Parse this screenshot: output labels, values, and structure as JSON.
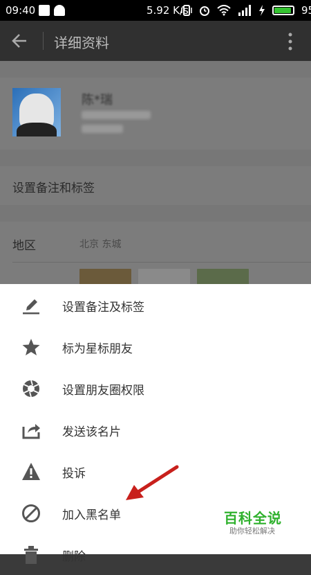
{
  "status_bar": {
    "time": "09:40",
    "network_speed": "5.92 K/s",
    "battery": "95",
    "battery_level": 0.95,
    "battery_color": "#35c431"
  },
  "app_bar": {
    "title": "详细资料",
    "back_icon": "back-arrow-icon",
    "more_icon": "more-vertical-icon"
  },
  "profile": {
    "nickname": "陈*瑞"
  },
  "rows": {
    "remark_label": "设置备注和标签",
    "region_label": "地区",
    "region_value": "北京  东城"
  },
  "menu": {
    "items": [
      {
        "label": "设置备注及标签",
        "icon": "edit-icon"
      },
      {
        "label": "标为星标朋友",
        "icon": "star-icon"
      },
      {
        "label": "设置朋友圈权限",
        "icon": "aperture-icon"
      },
      {
        "label": "发送该名片",
        "icon": "share-icon"
      },
      {
        "label": "投诉",
        "icon": "warning-icon"
      },
      {
        "label": "加入黑名单",
        "icon": "block-icon"
      },
      {
        "label": "删除",
        "icon": "trash-icon"
      }
    ]
  },
  "watermark": {
    "main": "百科全说",
    "sub": "助你轻松解决",
    "color": "#2fb12d"
  },
  "colors": {
    "annotation_arrow": "#c8201c",
    "app_bar": "#303030",
    "overlay": "#777777"
  }
}
